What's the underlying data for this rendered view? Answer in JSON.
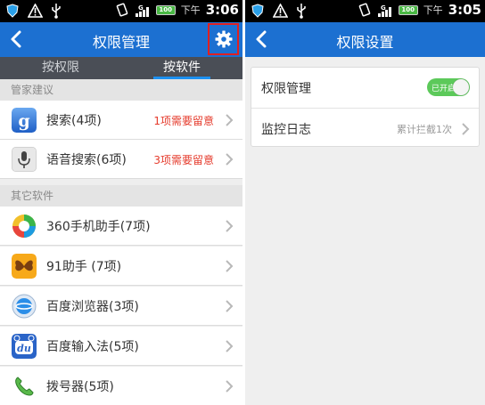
{
  "left": {
    "status": {
      "ampm": "下午",
      "time": "3:06",
      "battery": "100"
    },
    "title": "权限管理",
    "tabs": [
      {
        "label": "按权限",
        "active": false
      },
      {
        "label": "按软件",
        "active": true
      }
    ],
    "sections": [
      {
        "header": "管家建议",
        "items": [
          {
            "label": "搜索(4项)",
            "note": "1项需要留意",
            "icon": "google-search-icon"
          },
          {
            "label": "语音搜索(6项)",
            "note": "3项需要留意",
            "icon": "microphone-icon"
          }
        ]
      },
      {
        "header": "其它软件",
        "items": [
          {
            "label": "360手机助手(7项)",
            "note": "",
            "icon": "360-assistant-icon"
          },
          {
            "label": "91助手 (7项)",
            "note": "",
            "icon": "butterfly-91-icon"
          },
          {
            "label": "百度浏览器(3项)",
            "note": "",
            "icon": "baidu-browser-icon"
          },
          {
            "label": "百度输入法(5项)",
            "note": "",
            "icon": "baidu-input-icon"
          },
          {
            "label": "拨号器(5项)",
            "note": "",
            "icon": "phone-dialer-icon"
          }
        ]
      }
    ]
  },
  "right": {
    "status": {
      "ampm": "下午",
      "time": "3:05",
      "battery": "100"
    },
    "title": "权限设置",
    "rows": [
      {
        "label": "权限管理",
        "toggle_text": "已开启",
        "enabled": true
      },
      {
        "label": "监控日志",
        "value": "累计拦截1次"
      }
    ]
  },
  "colors": {
    "titlebar": "#1c70d1",
    "tabbar": "#4a4e56",
    "warning": "#e53b2c",
    "toggle_on": "#5cc95a",
    "highlight_box": "#e02020"
  }
}
